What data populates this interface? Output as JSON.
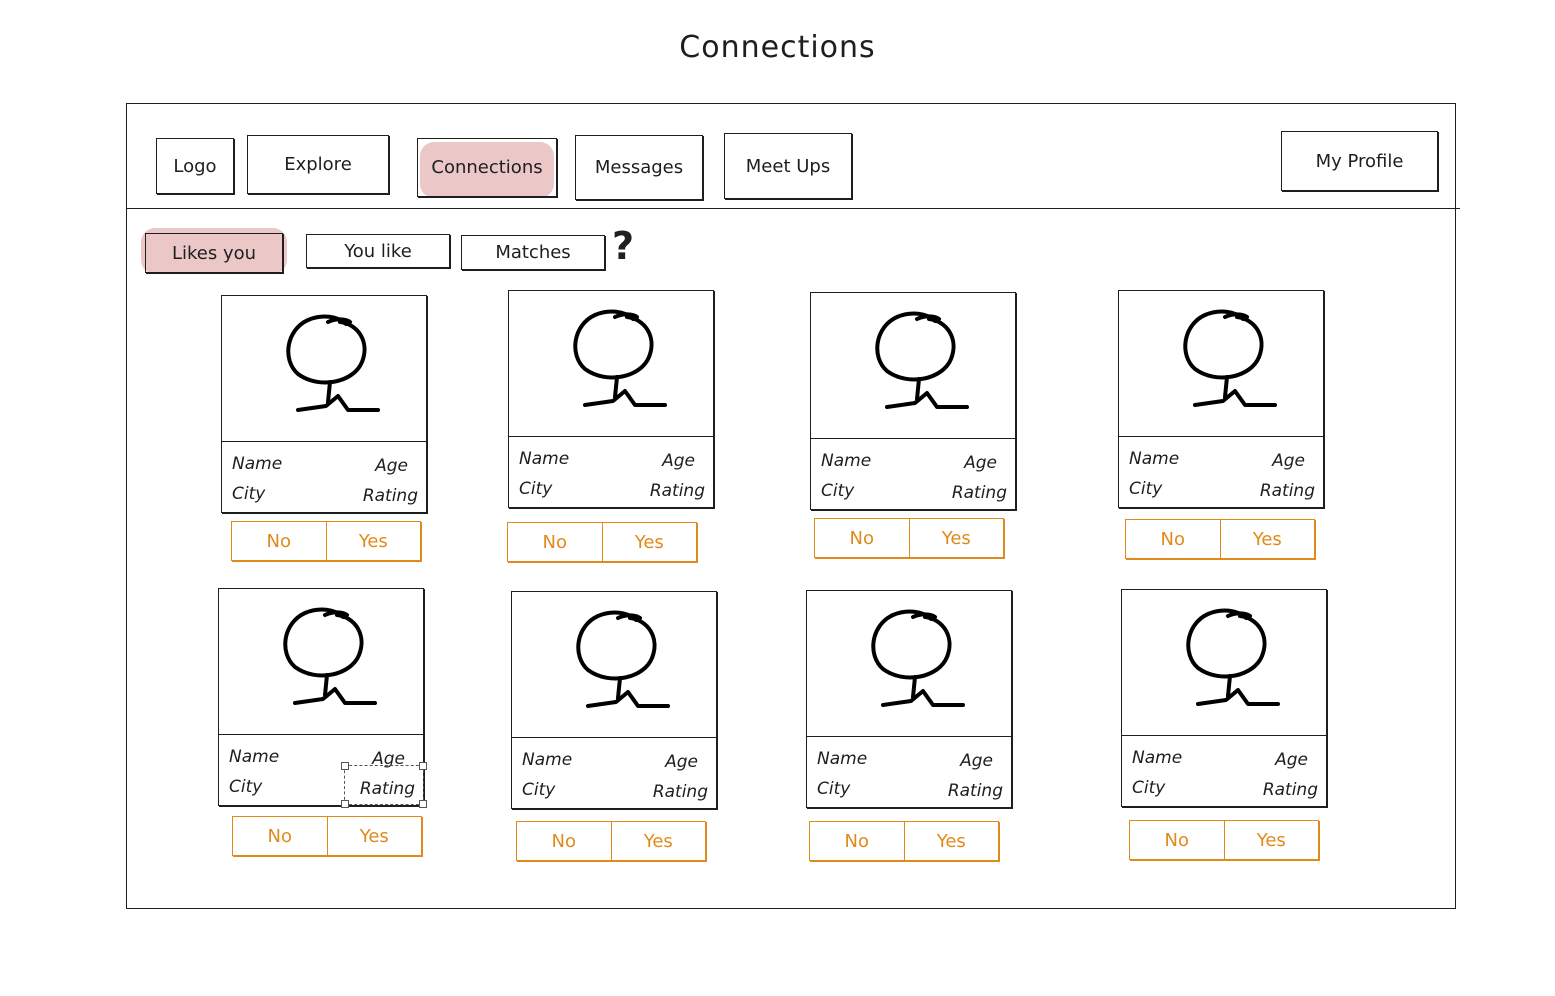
{
  "title": "Connections",
  "nav": {
    "logo": "Logo",
    "explore": "Explore",
    "connections": "Connections",
    "messages": "Messages",
    "meetups": "Meet Ups",
    "profile": "My Profile"
  },
  "filters": {
    "likes_you": "Likes you",
    "you_like": "You like",
    "matches": "Matches",
    "help": "?"
  },
  "colors": {
    "highlight": "#ebc8c7",
    "action": "#e08a1b",
    "ink": "#1e1e1e"
  },
  "cards": [
    {
      "name": "Name",
      "age": "Age",
      "city": "City",
      "rating": "Rating",
      "no": "No",
      "yes": "Yes"
    },
    {
      "name": "Name",
      "age": "Age",
      "city": "City",
      "rating": "Rating",
      "no": "No",
      "yes": "Yes"
    },
    {
      "name": "Name",
      "age": "Age",
      "city": "City",
      "rating": "Rating",
      "no": "No",
      "yes": "Yes"
    },
    {
      "name": "Name",
      "age": "Age",
      "city": "City",
      "rating": "Rating",
      "no": "No",
      "yes": "Yes"
    },
    {
      "name": "Name",
      "age": "Age",
      "city": "City",
      "rating": "Rating",
      "no": "No",
      "yes": "Yes"
    },
    {
      "name": "Name",
      "age": "Age",
      "city": "City",
      "rating": "Rating",
      "no": "No",
      "yes": "Yes"
    },
    {
      "name": "Name",
      "age": "Age",
      "city": "City",
      "rating": "Rating",
      "no": "No",
      "yes": "Yes"
    },
    {
      "name": "Name",
      "age": "Age",
      "city": "City",
      "rating": "Rating",
      "no": "No",
      "yes": "Yes"
    }
  ]
}
